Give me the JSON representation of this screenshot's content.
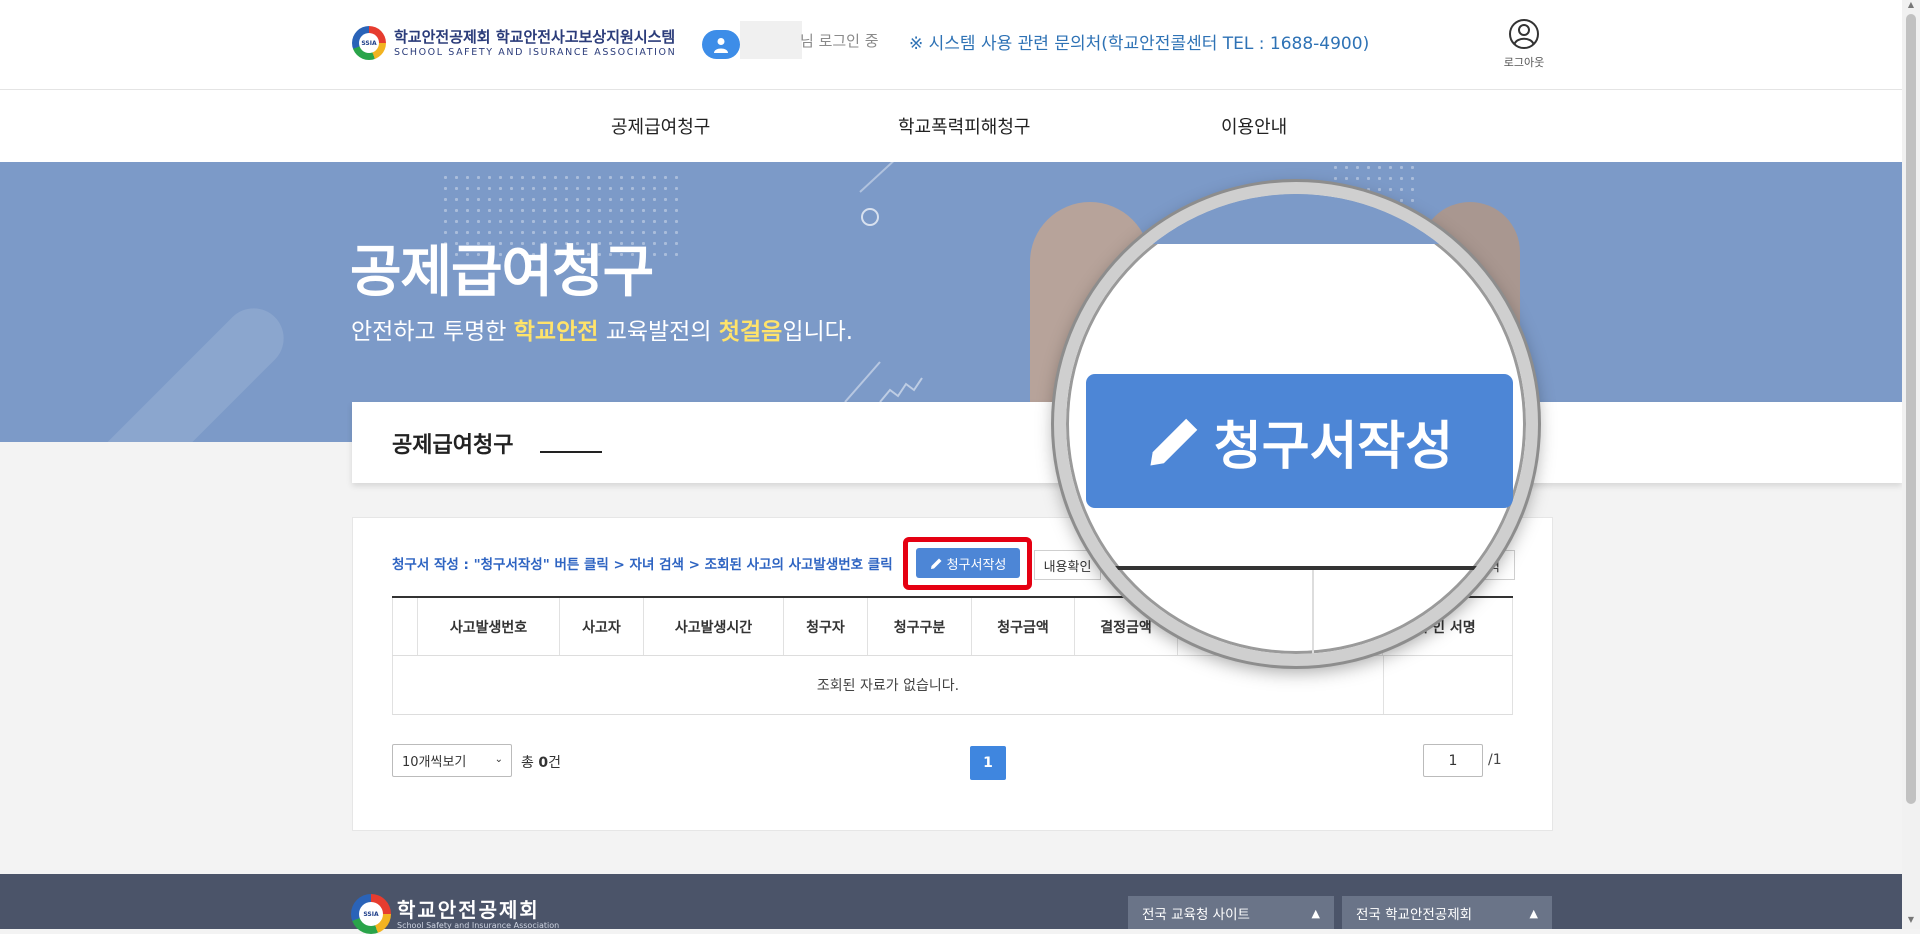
{
  "header": {
    "logo_emblem": "SSIA",
    "logo_title": "학교안전공제회 학교안전사고보상지원시스템",
    "logo_subtitle": "SCHOOL SAFETY AND ISURANCE ASSOCIATION",
    "login_text": "님 로그인 중",
    "contact_text": "※ 시스템 사용 관련 문의처(학교안전콜센터 TEL : 1688-4900)",
    "logout_label": "로그아웃",
    "user_icon": "user-icon",
    "logout_icon": "person-circle-icon"
  },
  "nav": {
    "items": [
      {
        "label": "공제급여청구"
      },
      {
        "label": "학교폭력피해청구"
      },
      {
        "label": "이용안내"
      }
    ]
  },
  "hero": {
    "title": "공제급여청구",
    "subtitle_prefix": "안전하고 투명한 ",
    "subtitle_hl1": "학교안전",
    "subtitle_mid": " 교육발전의 ",
    "subtitle_hl2": "첫걸음",
    "subtitle_suffix": "입니다."
  },
  "section": {
    "title": "공제급여청구"
  },
  "content": {
    "instruction": "청구서 작성 : \"청구서작성\" 버튼 클릭 > 자녀 검색 > 조회된 사고의 사고발생번호 클릭",
    "write_button": "청구서작성",
    "confirm_button": "내용확인",
    "right_button": "력",
    "pencil_icon": "pencil-icon",
    "table": {
      "headers": [
        "",
        "사고발생번호",
        "사고자",
        "사고발생시간",
        "청구자",
        "청구구분",
        "청구금액",
        "결정금액",
        "",
        "구인 서명"
      ],
      "empty_message": "조회된 자료가 없습니다."
    },
    "pager": {
      "page_size": "10개씩보기",
      "total_prefix": "총 ",
      "total_count": "0",
      "total_suffix": "건",
      "current_page": "1",
      "page_input": "1",
      "page_total": "/1"
    }
  },
  "magnifier": {
    "button_label": "청구서작성"
  },
  "footer": {
    "logo_title": "학교안전공제회",
    "logo_subtitle": "School Safety and Insurance Association",
    "select1": "전국 교육청 사이트",
    "select2": "전국 학교안전공제회"
  },
  "colors": {
    "accent": "#4d86d6",
    "hero_bg": "#7c9ac8",
    "highlight": "#ffe36a",
    "alert": "#e50012",
    "footer_bg": "#4b5469"
  }
}
